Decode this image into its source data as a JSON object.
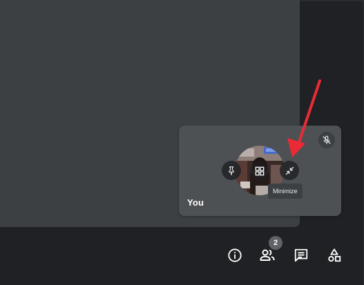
{
  "self_tile": {
    "name": "You",
    "mic_status": "muted",
    "buttons": {
      "pin_icon": "pin-icon",
      "layout_icon": "grid-icon",
      "minimize_icon": "minimize-icon"
    },
    "tooltip": "Minimize"
  },
  "toolbar": {
    "participants_count": "2",
    "icons": [
      "info-icon",
      "people-icon",
      "chat-icon",
      "activities-icon"
    ]
  },
  "colors": {
    "background": "#202124",
    "main_tile": "#3c4043",
    "self_tile": "#4d5154",
    "annotation_arrow": "#ea2b36"
  }
}
